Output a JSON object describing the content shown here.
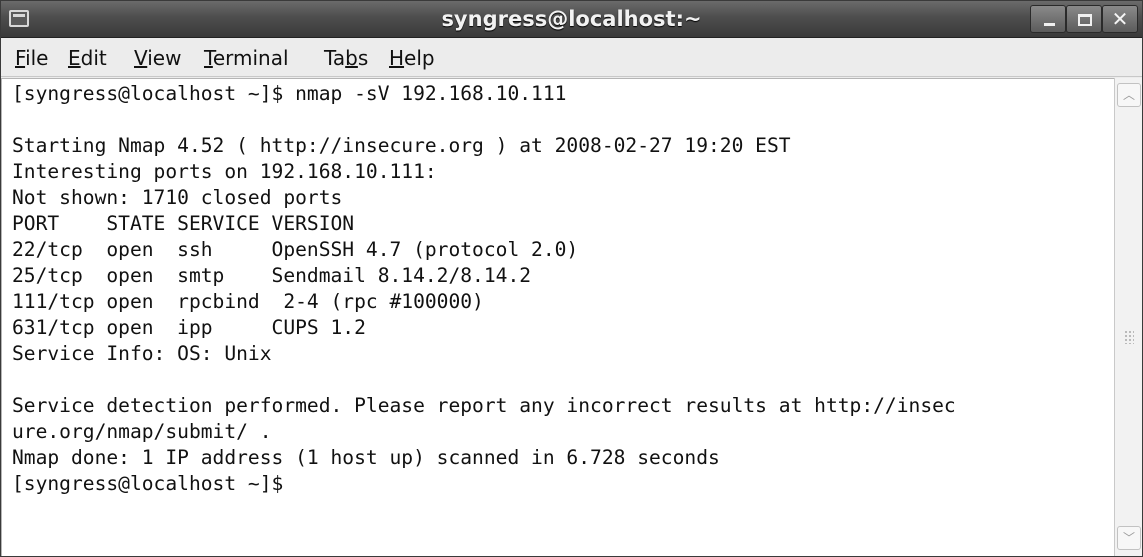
{
  "window": {
    "title": "syngress@localhost:~"
  },
  "menu": [
    {
      "pre": "",
      "ul": "F",
      "post": "ile"
    },
    {
      "pre": "",
      "ul": "E",
      "post": "dit"
    },
    {
      "pre": "",
      "ul": "V",
      "post": "iew"
    },
    {
      "pre": "",
      "ul": "T",
      "post": "erminal"
    },
    {
      "pre": "Ta",
      "ul": "b",
      "post": "s"
    },
    {
      "pre": "",
      "ul": "H",
      "post": "elp"
    }
  ],
  "terminal": {
    "lines": [
      "[syngress@localhost ~]$ nmap -sV 192.168.10.111",
      "",
      "Starting Nmap 4.52 ( http://insecure.org ) at 2008-02-27 19:20 EST",
      "Interesting ports on 192.168.10.111:",
      "Not shown: 1710 closed ports",
      "PORT    STATE SERVICE VERSION",
      "22/tcp  open  ssh     OpenSSH 4.7 (protocol 2.0)",
      "25/tcp  open  smtp    Sendmail 8.14.2/8.14.2",
      "111/tcp open  rpcbind  2-4 (rpc #100000)",
      "631/tcp open  ipp     CUPS 1.2",
      "Service Info: OS: Unix",
      "",
      "Service detection performed. Please report any incorrect results at http://insec",
      "ure.org/nmap/submit/ .",
      "Nmap done: 1 IP address (1 host up) scanned in 6.728 seconds",
      "[syngress@localhost ~]$"
    ]
  },
  "icons": {
    "app": "terminal-icon",
    "minimize": "minimize-icon",
    "maximize": "maximize-icon",
    "close": "close-icon",
    "scroll_up": "chevron-up-icon",
    "scroll_down": "chevron-down-icon"
  }
}
